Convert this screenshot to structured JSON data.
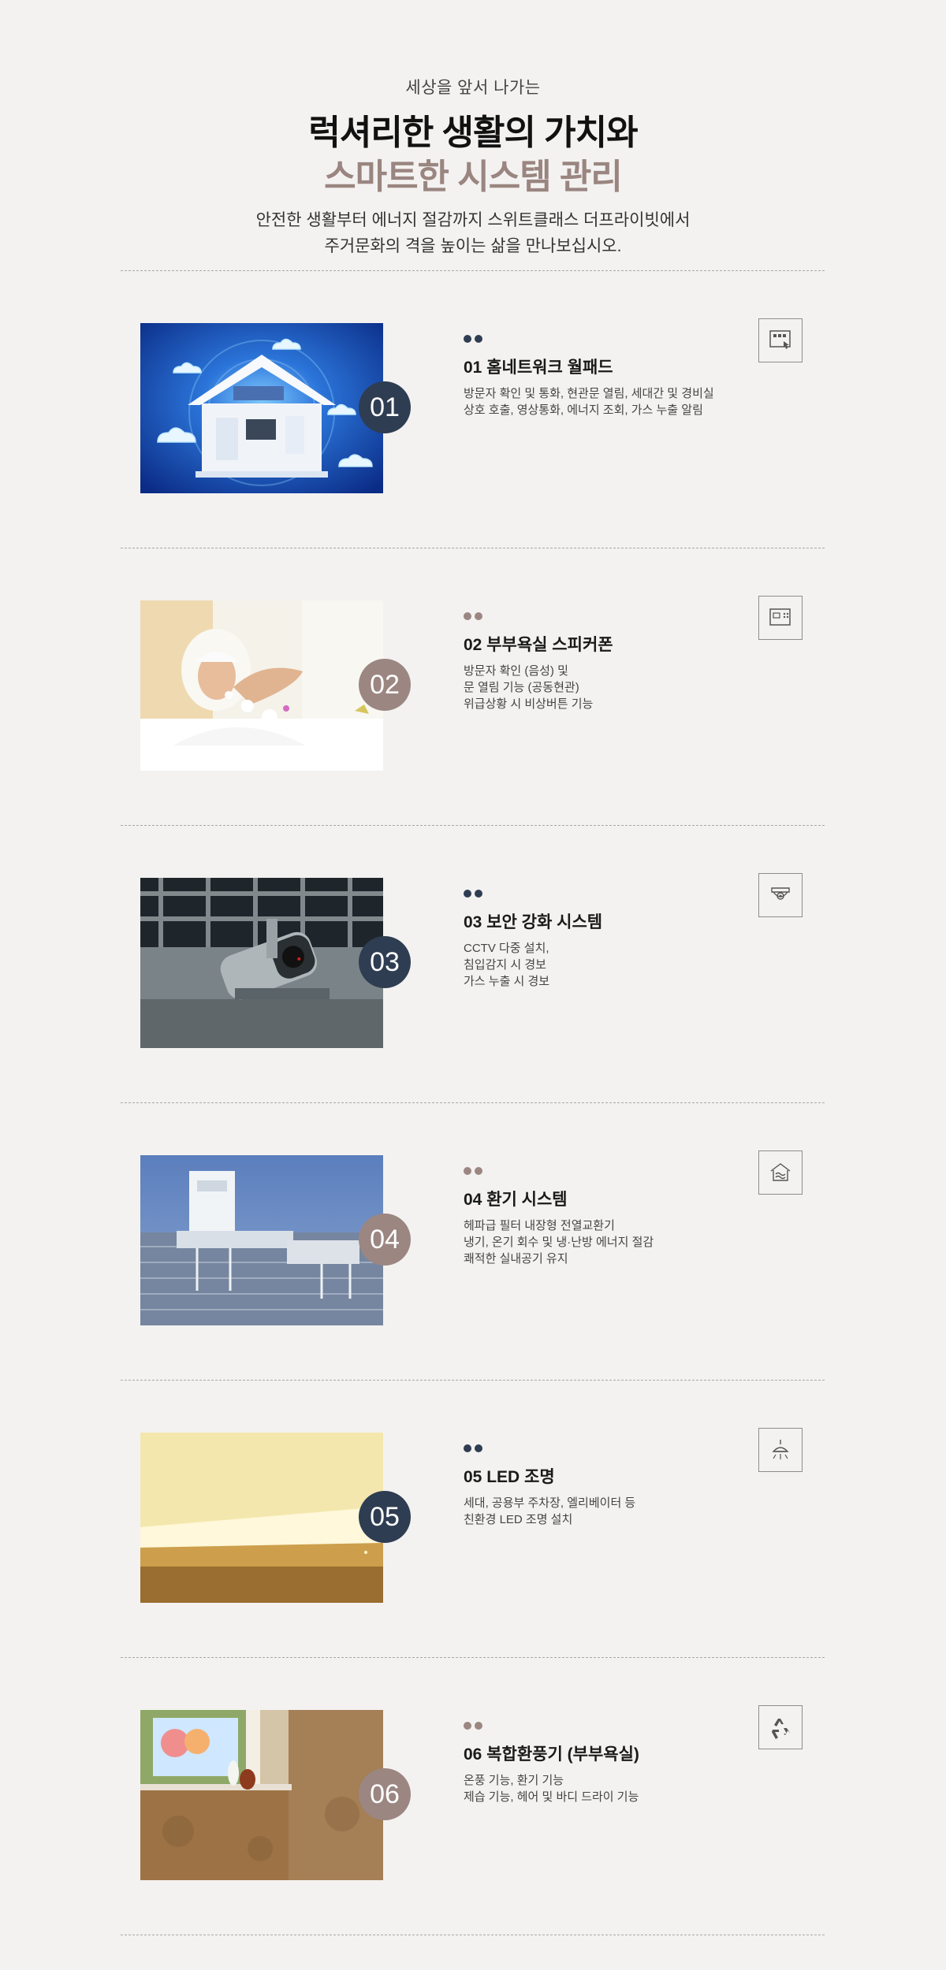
{
  "hero": {
    "eyebrow": "세상을 앞서 나가는",
    "title_line1": "럭셔리한 생활의 가치와",
    "title_line2": "스마트한 시스템 관리",
    "desc_line1": "안전한 생활부터 에너지 절감까지 스위트클래스 더프라이빗에서",
    "desc_line2": "주거문화의 격을 높이는 삶을 만나보십시오."
  },
  "colors": {
    "accent_dark": "#2f3d52",
    "accent_taupe": "#9b8682",
    "background": "#f3f2f1"
  },
  "features": [
    {
      "number": "01",
      "title": "01 홈네트워크 월패드",
      "desc": [
        "방문자 확인 및 통화, 현관문 열림, 세대간 및 경비실",
        "상호 호출, 영상통화, 에너지 조회, 가스 누출 알림"
      ],
      "icon": "wallpad-icon",
      "theme": "dark"
    },
    {
      "number": "02",
      "title": "02 부부욕실 스피커폰",
      "desc": [
        "방문자 확인 (음성) 및",
        "문 열림 기능 (공동현관)",
        "위급상황 시 비상버튼 기능"
      ],
      "icon": "speakerphone-icon",
      "theme": "taupe"
    },
    {
      "number": "03",
      "title": "03 보안 강화 시스템",
      "desc": [
        "CCTV 다중 설치,",
        "침입감지 시 경보",
        "가스 누출 시 경보"
      ],
      "icon": "cctv-icon",
      "theme": "dark"
    },
    {
      "number": "04",
      "title": "04 환기 시스템",
      "desc": [
        "헤파급 필터 내장형 전열교환기",
        "냉기, 온기 회수 및 냉·난방 에너지 절감",
        "쾌적한 실내공기 유지"
      ],
      "icon": "ventilation-icon",
      "theme": "taupe"
    },
    {
      "number": "05",
      "title": "05 LED 조명",
      "desc": [
        "세대, 공용부 주차장, 엘리베이터 등",
        "친환경 LED 조명 설치"
      ],
      "icon": "ceiling-light-icon",
      "theme": "dark"
    },
    {
      "number": "06",
      "title": "06 복합환풍기 (부부욕실)",
      "desc": [
        "온풍 기능, 환기 기능",
        "제습 기능, 헤어 및 바디 드라이 기능"
      ],
      "icon": "recycle-fan-icon",
      "theme": "taupe"
    }
  ]
}
